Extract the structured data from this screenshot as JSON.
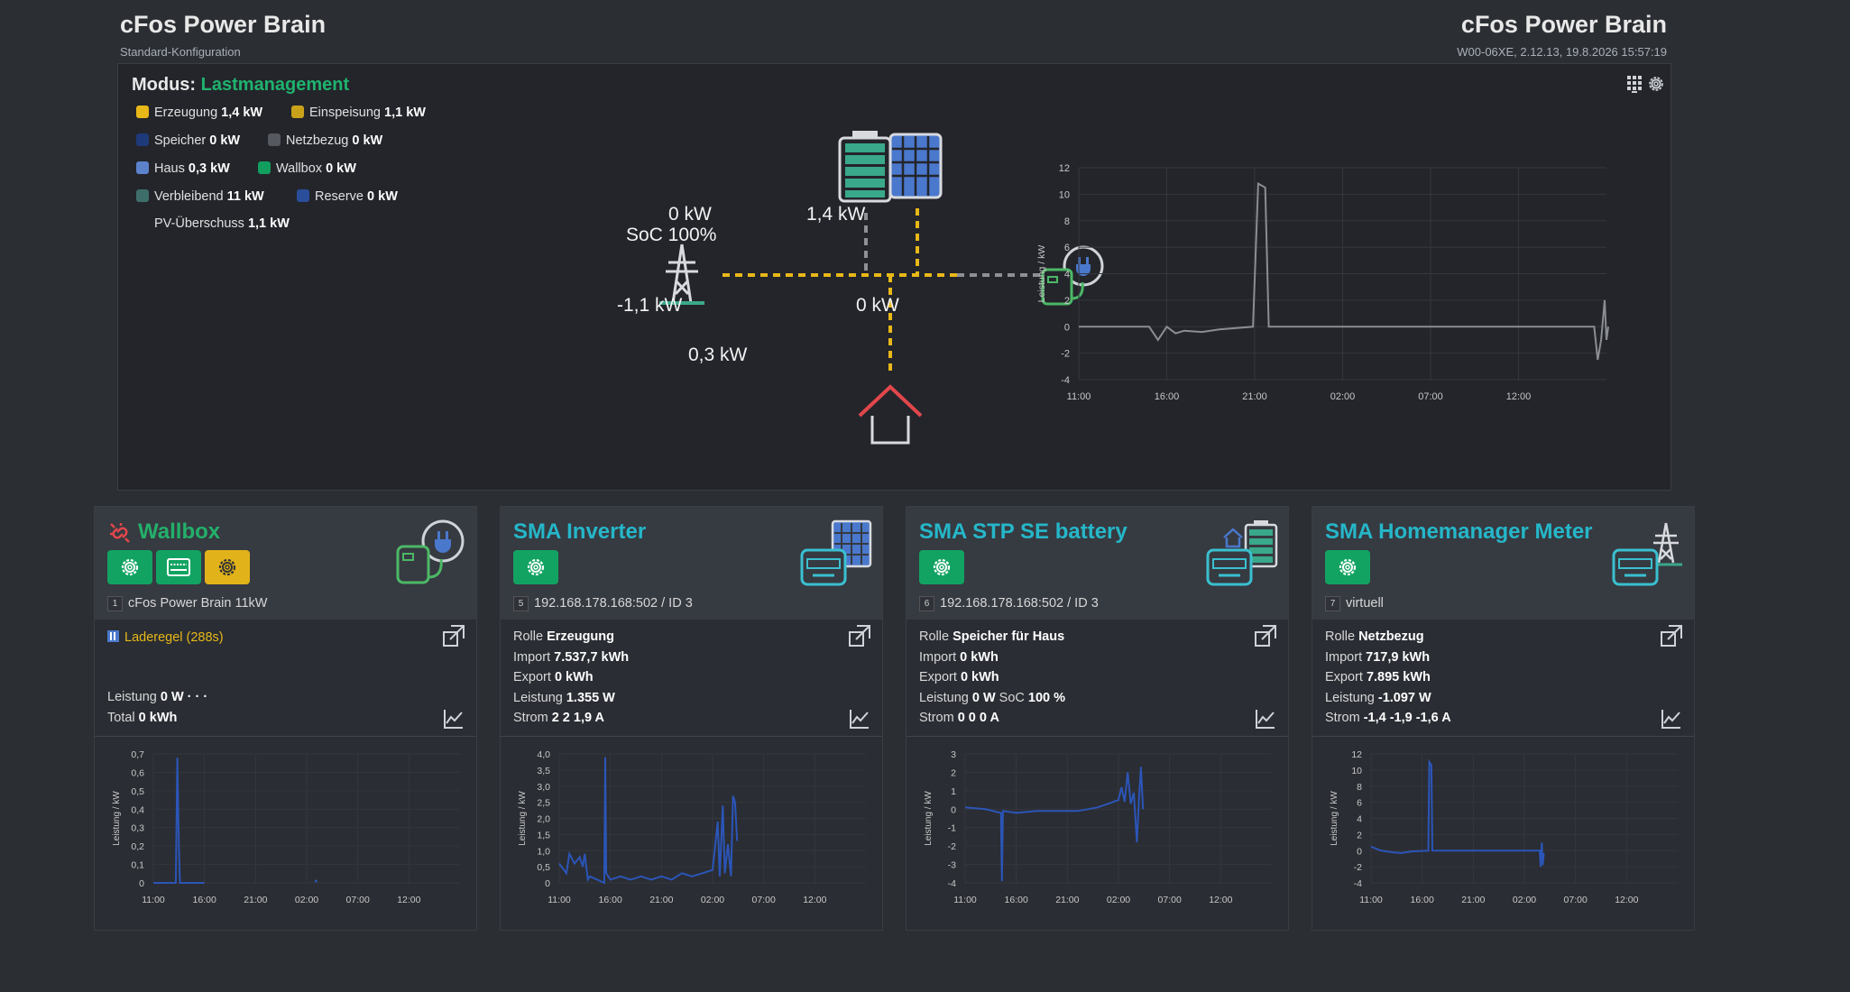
{
  "header": {
    "left_title": "cFos Power Brain",
    "left_subtitle": "Standard-Konfiguration",
    "right_title": "cFos Power Brain",
    "right_subtitle": "W00-06XE, 2.12.13, 19.8.2026 15:57:19"
  },
  "overview": {
    "mode_label": "Modus:",
    "mode_value": "Lastmanagement",
    "legend": [
      {
        "label": "Erzeugung",
        "value": "1,4 kW",
        "color": "#e8b818"
      },
      {
        "label": "Einspeisung",
        "value": "1,1 kW",
        "color": "#c9a21a"
      },
      {
        "label": "Speicher",
        "value": "0 kW",
        "color": "#1f3a7a"
      },
      {
        "label": "Netzbezug",
        "value": "0 kW",
        "color": "#55585e"
      },
      {
        "label": "Haus",
        "value": "0,3 kW",
        "color": "#5d82cc"
      },
      {
        "label": "Wallbox",
        "value": "0 kW",
        "color": "#129e5e"
      },
      {
        "label": "Verbleibend",
        "value": "11 kW",
        "color": "#3e6e6a"
      },
      {
        "label": "Reserve",
        "value": "0 kW",
        "color": "#2a4e9a"
      }
    ],
    "pv_label": "PV-Überschuss",
    "pv_value": "1,1 kW",
    "flow": {
      "battery_kw": "0 kW",
      "soc": "SoC 100%",
      "solar_kw": "1,4 kW",
      "grid_kw": "-1,1 kW",
      "wallbox_kw": "0 kW",
      "house_kw": "0,3 kW"
    }
  },
  "charts": {
    "main": {
      "type": "line",
      "ylabel": "Leistung / kW",
      "yticks": [
        "12",
        "10",
        "8",
        "6",
        "4",
        "2",
        "0",
        "-2",
        "-4"
      ],
      "xticks": [
        "11:00",
        "16:00",
        "21:00",
        "02:00",
        "07:00",
        "12:00"
      ],
      "ylim": [
        -4,
        12
      ],
      "color": "#8a8d92",
      "points": [
        [
          0,
          0
        ],
        [
          4,
          0
        ],
        [
          4.5,
          -1
        ],
        [
          5,
          0
        ],
        [
          5.5,
          -0.5
        ],
        [
          6,
          -0.3
        ],
        [
          7,
          -0.4
        ],
        [
          8,
          -0.2
        ],
        [
          9.9,
          0
        ],
        [
          10.2,
          10.8
        ],
        [
          10.6,
          10.5
        ],
        [
          10.8,
          0
        ],
        [
          20,
          0
        ],
        [
          29.3,
          0
        ],
        [
          29.5,
          -2.5
        ],
        [
          29.7,
          -1
        ],
        [
          29.9,
          2
        ],
        [
          30,
          -1
        ],
        [
          30.1,
          0
        ]
      ]
    },
    "wallbox": {
      "type": "line",
      "ylabel": "Leistung / kW",
      "yticks": [
        "0,7",
        "0,6",
        "0,5",
        "0,4",
        "0,3",
        "0,2",
        "0,1",
        "0"
      ],
      "xticks": [
        "11:00",
        "16:00",
        "21:00",
        "02:00",
        "07:00",
        "12:00"
      ],
      "ylim": [
        0,
        0.7
      ],
      "color": "#2b55b8",
      "points": [
        [
          0,
          0
        ],
        [
          2.2,
          0
        ],
        [
          2.35,
          0.68
        ],
        [
          2.5,
          0.2
        ],
        [
          2.6,
          0
        ],
        [
          5,
          0
        ]
      ],
      "tail": [
        [
          15.9,
          0.01
        ]
      ]
    },
    "inverter": {
      "type": "line",
      "ylabel": "Leistung / kW",
      "yticks": [
        "4,0",
        "3,5",
        "3,0",
        "2,5",
        "2,0",
        "1,5",
        "1,0",
        "0,5",
        "0"
      ],
      "xticks": [
        "11:00",
        "16:00",
        "21:00",
        "02:00",
        "07:00",
        "12:00"
      ],
      "ylim": [
        0,
        4
      ],
      "color": "#2b55b8",
      "points": [
        [
          0,
          0.6
        ],
        [
          0.7,
          0.3
        ],
        [
          1,
          0.9
        ],
        [
          1.5,
          0.6
        ],
        [
          2,
          0.8
        ],
        [
          2.3,
          0.5
        ],
        [
          2.5,
          0.9
        ],
        [
          2.8,
          0.1
        ],
        [
          3,
          0.2
        ],
        [
          4.4,
          0
        ],
        [
          4.5,
          3.9
        ],
        [
          4.6,
          0.3
        ],
        [
          5,
          0.1
        ],
        [
          6,
          0.2
        ],
        [
          7,
          0.1
        ],
        [
          8,
          0.2
        ],
        [
          9,
          0.1
        ],
        [
          10,
          0.2
        ],
        [
          11,
          0.1
        ],
        [
          12,
          0.3
        ],
        [
          13,
          0.2
        ],
        [
          14,
          0.3
        ],
        [
          15,
          0.4
        ],
        [
          15.5,
          1.9
        ],
        [
          15.7,
          0.2
        ],
        [
          16,
          2.4
        ],
        [
          16.2,
          0.3
        ],
        [
          16.5,
          1.2
        ],
        [
          16.8,
          0.2
        ],
        [
          17,
          2.7
        ],
        [
          17.2,
          2.5
        ],
        [
          17.4,
          1.3
        ]
      ]
    },
    "battery": {
      "type": "line",
      "ylabel": "Leistung / kW",
      "yticks": [
        "3",
        "2",
        "1",
        "0",
        "-1",
        "-2",
        "-3",
        "-4"
      ],
      "xticks": [
        "11:00",
        "16:00",
        "21:00",
        "02:00",
        "07:00",
        "12:00"
      ],
      "ylim": [
        -4,
        3
      ],
      "color": "#2b55b8",
      "points": [
        [
          0,
          0.1
        ],
        [
          2,
          0
        ],
        [
          3.5,
          -0.2
        ],
        [
          3.6,
          -3.9
        ],
        [
          3.7,
          -0.1
        ],
        [
          5,
          -0.2
        ],
        [
          7,
          -0.1
        ],
        [
          9,
          -0.1
        ],
        [
          11,
          -0.1
        ],
        [
          12,
          0
        ],
        [
          13,
          0.1
        ],
        [
          14,
          0.3
        ],
        [
          15,
          0.5
        ],
        [
          15.3,
          1.2
        ],
        [
          15.6,
          0.4
        ],
        [
          15.9,
          2.0
        ],
        [
          16.2,
          0.3
        ],
        [
          16.5,
          0.9
        ],
        [
          16.8,
          -1.8
        ],
        [
          17,
          0.5
        ],
        [
          17.2,
          2.3
        ],
        [
          17.4,
          0
        ]
      ]
    },
    "meter": {
      "type": "line",
      "ylabel": "Leistung / kW",
      "yticks": [
        "12",
        "10",
        "8",
        "6",
        "4",
        "2",
        "0",
        "-2",
        "-4"
      ],
      "xticks": [
        "11:00",
        "16:00",
        "21:00",
        "02:00",
        "07:00",
        "12:00"
      ],
      "ylim": [
        -4,
        12
      ],
      "color": "#2b55b8",
      "points": [
        [
          0,
          0.5
        ],
        [
          1,
          0
        ],
        [
          2,
          -0.2
        ],
        [
          3,
          -0.3
        ],
        [
          4,
          -0.1
        ],
        [
          5.6,
          0
        ],
        [
          5.7,
          11
        ],
        [
          5.9,
          10.6
        ],
        [
          6,
          0
        ],
        [
          16.5,
          0
        ],
        [
          16.6,
          -2
        ],
        [
          16.7,
          1
        ],
        [
          16.8,
          -1.8
        ],
        [
          16.9,
          -0.3
        ]
      ]
    }
  },
  "cards": [
    {
      "title": "Wallbox",
      "id": "1",
      "id_text": "cFos Power Brain 11kW",
      "status": "Laderegel (288s)",
      "lines": [
        {
          "k": "Leistung",
          "v": "0 W · · ·"
        },
        {
          "k": "Total",
          "v": "0 kWh"
        }
      ]
    },
    {
      "title": "SMA Inverter",
      "id": "5",
      "id_text": "192.168.178.168:502 / ID 3",
      "lines": [
        {
          "k": "Rolle",
          "v": "Erzeugung"
        },
        {
          "k": "Import",
          "v": "7.537,7 kWh"
        },
        {
          "k": "Export",
          "v": "0 kWh"
        },
        {
          "k": "Leistung",
          "v": "1.355 W"
        },
        {
          "k": "Strom",
          "v": "2 2 1,9 A"
        }
      ]
    },
    {
      "title": "SMA STP SE battery",
      "id": "6",
      "id_text": "192.168.178.168:502 / ID 3",
      "lines": [
        {
          "k": "Rolle",
          "v": "Speicher für Haus"
        },
        {
          "k": "Import",
          "v": "0 kWh"
        },
        {
          "k": "Export",
          "v": "0 kWh"
        },
        {
          "k": "Leistung",
          "v": "0 W",
          "k2": "SoC",
          "v2": "100 %"
        },
        {
          "k": "Strom",
          "v": "0 0 0 A"
        }
      ]
    },
    {
      "title": "SMA Homemanager Meter",
      "id": "7",
      "id_text": "virtuell",
      "lines": [
        {
          "k": "Rolle",
          "v": "Netzbezug"
        },
        {
          "k": "Import",
          "v": "717,9 kWh"
        },
        {
          "k": "Export",
          "v": "7.895 kWh"
        },
        {
          "k": "Leistung",
          "v": "-1.097 W"
        },
        {
          "k": "Strom",
          "v": "-1,4 -1,9 -1,6 A"
        }
      ]
    }
  ]
}
